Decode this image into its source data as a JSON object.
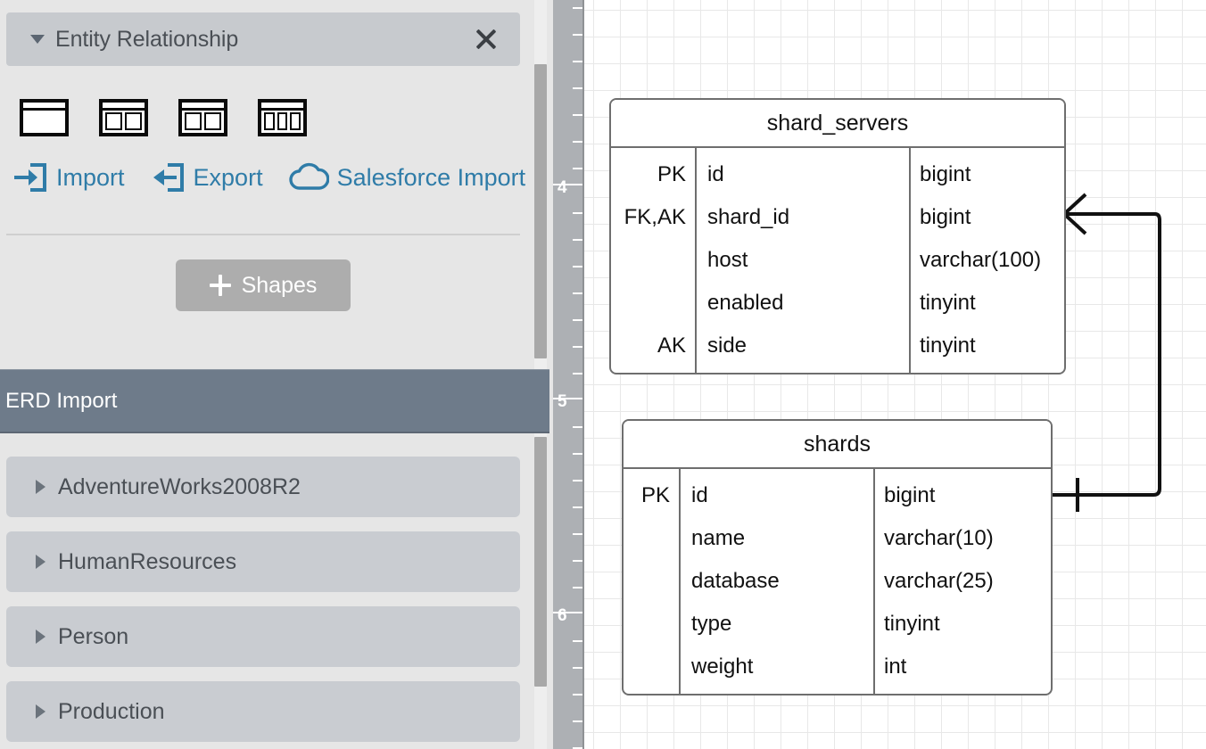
{
  "sidebar": {
    "section": {
      "title": "Entity Relationship",
      "caret_icon": "caret-down-icon",
      "close_icon": "close-icon"
    },
    "shape_palette": [
      {
        "name": "entity-shape-1-column",
        "columns": 1
      },
      {
        "name": "entity-shape-2-column-narrow-left",
        "columns": 2
      },
      {
        "name": "entity-shape-2-column-even",
        "columns": 2
      },
      {
        "name": "entity-shape-3-column",
        "columns": 3
      }
    ],
    "links": [
      {
        "label": "Import",
        "icon": "import-arrow-icon"
      },
      {
        "label": "Export",
        "icon": "export-arrow-icon"
      },
      {
        "label": "Salesforce Import",
        "icon": "cloud-icon"
      }
    ],
    "shapes_button": {
      "label": "Shapes",
      "icon": "plus-icon"
    },
    "erd_import": {
      "label": "ERD Import"
    },
    "tree_items": [
      {
        "label": "AdventureWorks2008R2",
        "caret_icon": "caret-right-icon"
      },
      {
        "label": "HumanResources",
        "caret_icon": "caret-right-icon"
      },
      {
        "label": "Person",
        "caret_icon": "caret-right-icon"
      },
      {
        "label": "Production",
        "caret_icon": "caret-right-icon"
      }
    ],
    "accent_color": "#2f7ca8",
    "erd_bar_color": "#6e7b8a"
  },
  "ruler": {
    "orientation": "vertical",
    "labels": [
      "4",
      "5",
      "6"
    ]
  },
  "canvas": {
    "entities": [
      {
        "name": "shard_servers",
        "rows": [
          {
            "key": "PK",
            "field": "id",
            "type": "bigint"
          },
          {
            "key": "FK,AK",
            "field": "shard_id",
            "type": "bigint"
          },
          {
            "key": "",
            "field": "host",
            "type": "varchar(100)"
          },
          {
            "key": "",
            "field": "enabled",
            "type": "tinyint"
          },
          {
            "key": "AK",
            "field": "side",
            "type": "tinyint"
          }
        ]
      },
      {
        "name": "shards",
        "rows": [
          {
            "key": "PK",
            "field": "id",
            "type": "bigint"
          },
          {
            "key": "",
            "field": "name",
            "type": "varchar(10)"
          },
          {
            "key": "",
            "field": "database",
            "type": "varchar(25)"
          },
          {
            "key": "",
            "field": "type",
            "type": "tinyint"
          },
          {
            "key": "",
            "field": "weight",
            "type": "int"
          }
        ]
      }
    ],
    "relationship": {
      "from_entity": "shards",
      "to_entity": "shard_servers",
      "from_cardinality": "one",
      "to_cardinality": "many",
      "notation": "crows-foot"
    }
  }
}
